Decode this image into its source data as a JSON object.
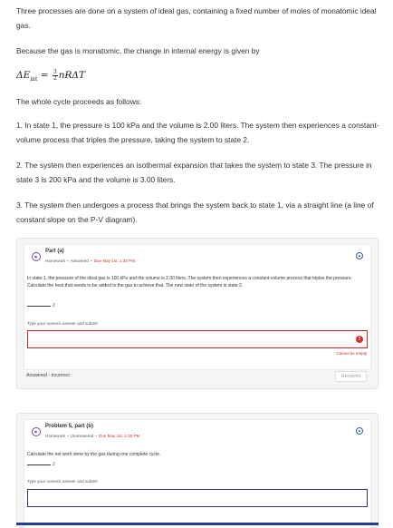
{
  "intro": {
    "p1": "Three processes are done on a system of ideal gas, containing a fixed number of moles of monatomic ideal gas.",
    "p2": "Because the gas is monatomic, the change in internal energy is given by",
    "eq_lhs": "ΔE",
    "eq_sub": "int",
    "eq_eq": " = ",
    "eq_num": "3",
    "eq_den": "2",
    "eq_rhs": "nRΔT",
    "p3": "The whole cycle proceeds as follows:",
    "p4": "1. In state 1, the pressure is 100 kPa and the volume is 2.00 liters. The system then experiences a constant-volume process that triples the pressure, taking the system to state 2.",
    "p5": "2. The system then experiences an isothermal expansion that takes the system to state 3. The pressure in state 3 is 200 kPa and the volume is 3.00 liters.",
    "p6": "3. The system then undergoes a process that brings the system back to state 1, via a straight line (a line of constant slope on the P-V diagram)."
  },
  "part_a": {
    "title": "Part (a)",
    "type": "Homework",
    "state": "Answered",
    "due": "Due May 1st, 1:30 PM",
    "question": "In state 1, the pressure of the ideal gas is 100 kPa and the volume is 2.00 liters. The system then experiences a constant-volume process that triples the pressure. Calculate the heat that needs to be added to the gas to achieve that. The new state of the system is state 2.",
    "unit": "J",
    "instruction": "Type your numeric answer and submit",
    "input_value": "",
    "error_icon": "!",
    "error": "Cannot be empty",
    "status": "Answered - Incorrect",
    "resubmit": "Resubmit"
  },
  "part_b": {
    "title": "Problem 5, part (b)",
    "type": "Homework",
    "state": "Unanswered",
    "due": "Due May 1st, 1:30 PM",
    "question": "Calculate the net work done by the gas during one complete cycle.",
    "unit": "J",
    "instruction": "Type your numeric answer and submit",
    "input_value": ""
  },
  "icons": {
    "question": "question-icon",
    "info": "info-icon",
    "error": "error-icon"
  },
  "colors": {
    "error": "#c62828",
    "accent": "#2a5fa8",
    "purple": "#7a4aa0",
    "due": "#c0392b"
  }
}
